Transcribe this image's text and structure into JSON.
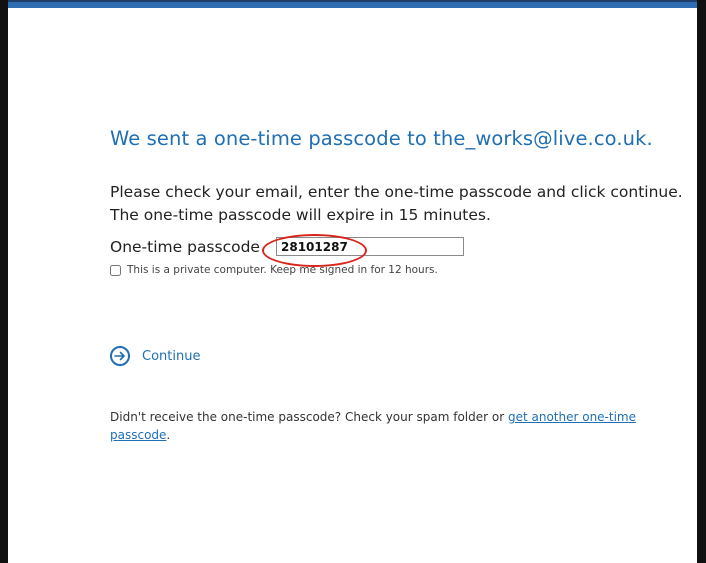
{
  "heading": "We sent a one-time passcode to the_works@live.co.uk.",
  "instructions": {
    "line1": "Please check your email, enter the one-time passcode and click continue.",
    "line2": "The one-time passcode will expire in 15 minutes."
  },
  "otp": {
    "label": "One-time passcode",
    "value": "28101287"
  },
  "keep_signed_in": {
    "label": "This is a private computer. Keep me signed in for 12 hours.",
    "checked": false
  },
  "continue": {
    "label": "Continue",
    "icon": "arrow-right-circle-icon"
  },
  "footer": {
    "text_prefix": "Didn't receive the one-time passcode? Check your spam folder or ",
    "link_label": "get another one-time passcode",
    "text_suffix": "."
  },
  "colors": {
    "accent": "#1f6fb5",
    "annotation": "#d9261c",
    "top_bar": "#2f6db3"
  }
}
